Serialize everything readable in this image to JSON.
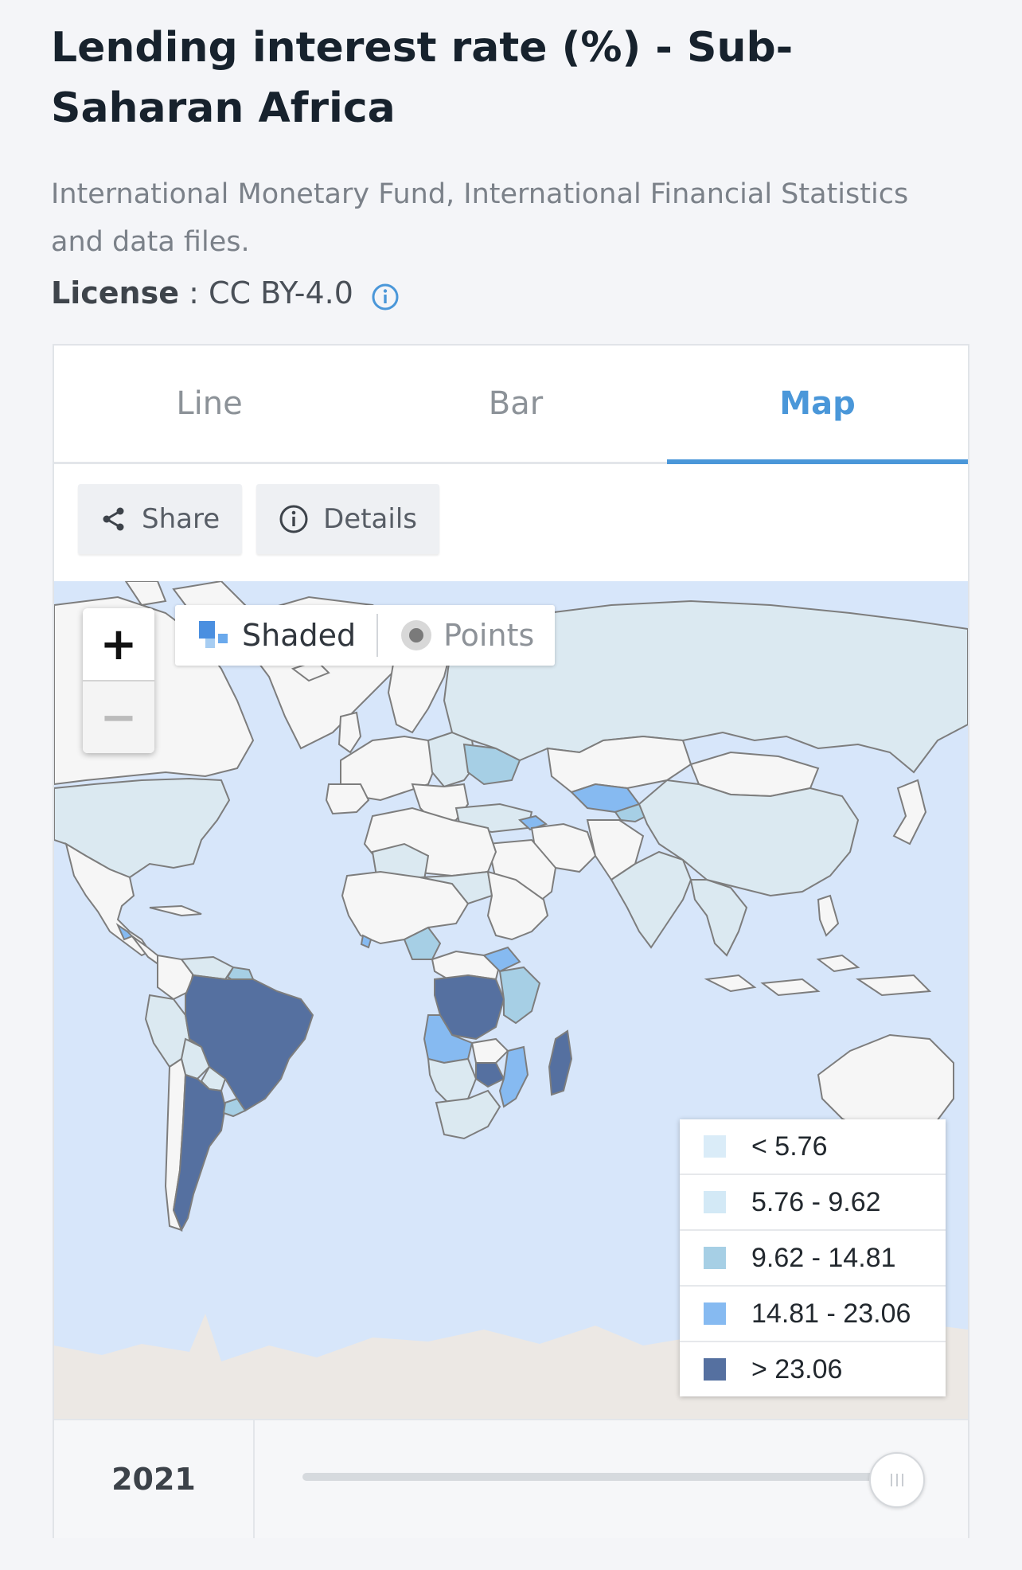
{
  "page": {
    "title": "Lending interest rate (%) - Sub-Saharan Africa",
    "source": "International Monetary Fund, International Financial Statistics and data files.",
    "license_label": "License",
    "license_sep": " : ",
    "license_value": "CC BY-4.0"
  },
  "tabs": [
    {
      "label": "Line",
      "active": false
    },
    {
      "label": "Bar",
      "active": false
    },
    {
      "label": "Map",
      "active": true
    }
  ],
  "toolbar": {
    "share_label": "Share",
    "details_label": "Details"
  },
  "map": {
    "zoom_in": "+",
    "zoom_out": "−",
    "mode_shaded": "Shaded",
    "mode_points": "Points",
    "colors": {
      "ocean": "#d7e6fa",
      "land_nodata": "#f6f6f6",
      "antarctica": "#ece8e4",
      "border": "#7d7d7d"
    },
    "legend": [
      {
        "label": "< 5.76",
        "color": "#daecf8"
      },
      {
        "label": "5.76 - 9.62",
        "color": "#d3e9f6"
      },
      {
        "label": "9.62 - 14.81",
        "color": "#a6cfe5"
      },
      {
        "label": "14.81 - 23.06",
        "color": "#86baf1"
      },
      {
        "label": "> 23.06",
        "color": "#5570a0"
      }
    ]
  },
  "timeline": {
    "year": "2021",
    "position": 1.0
  }
}
